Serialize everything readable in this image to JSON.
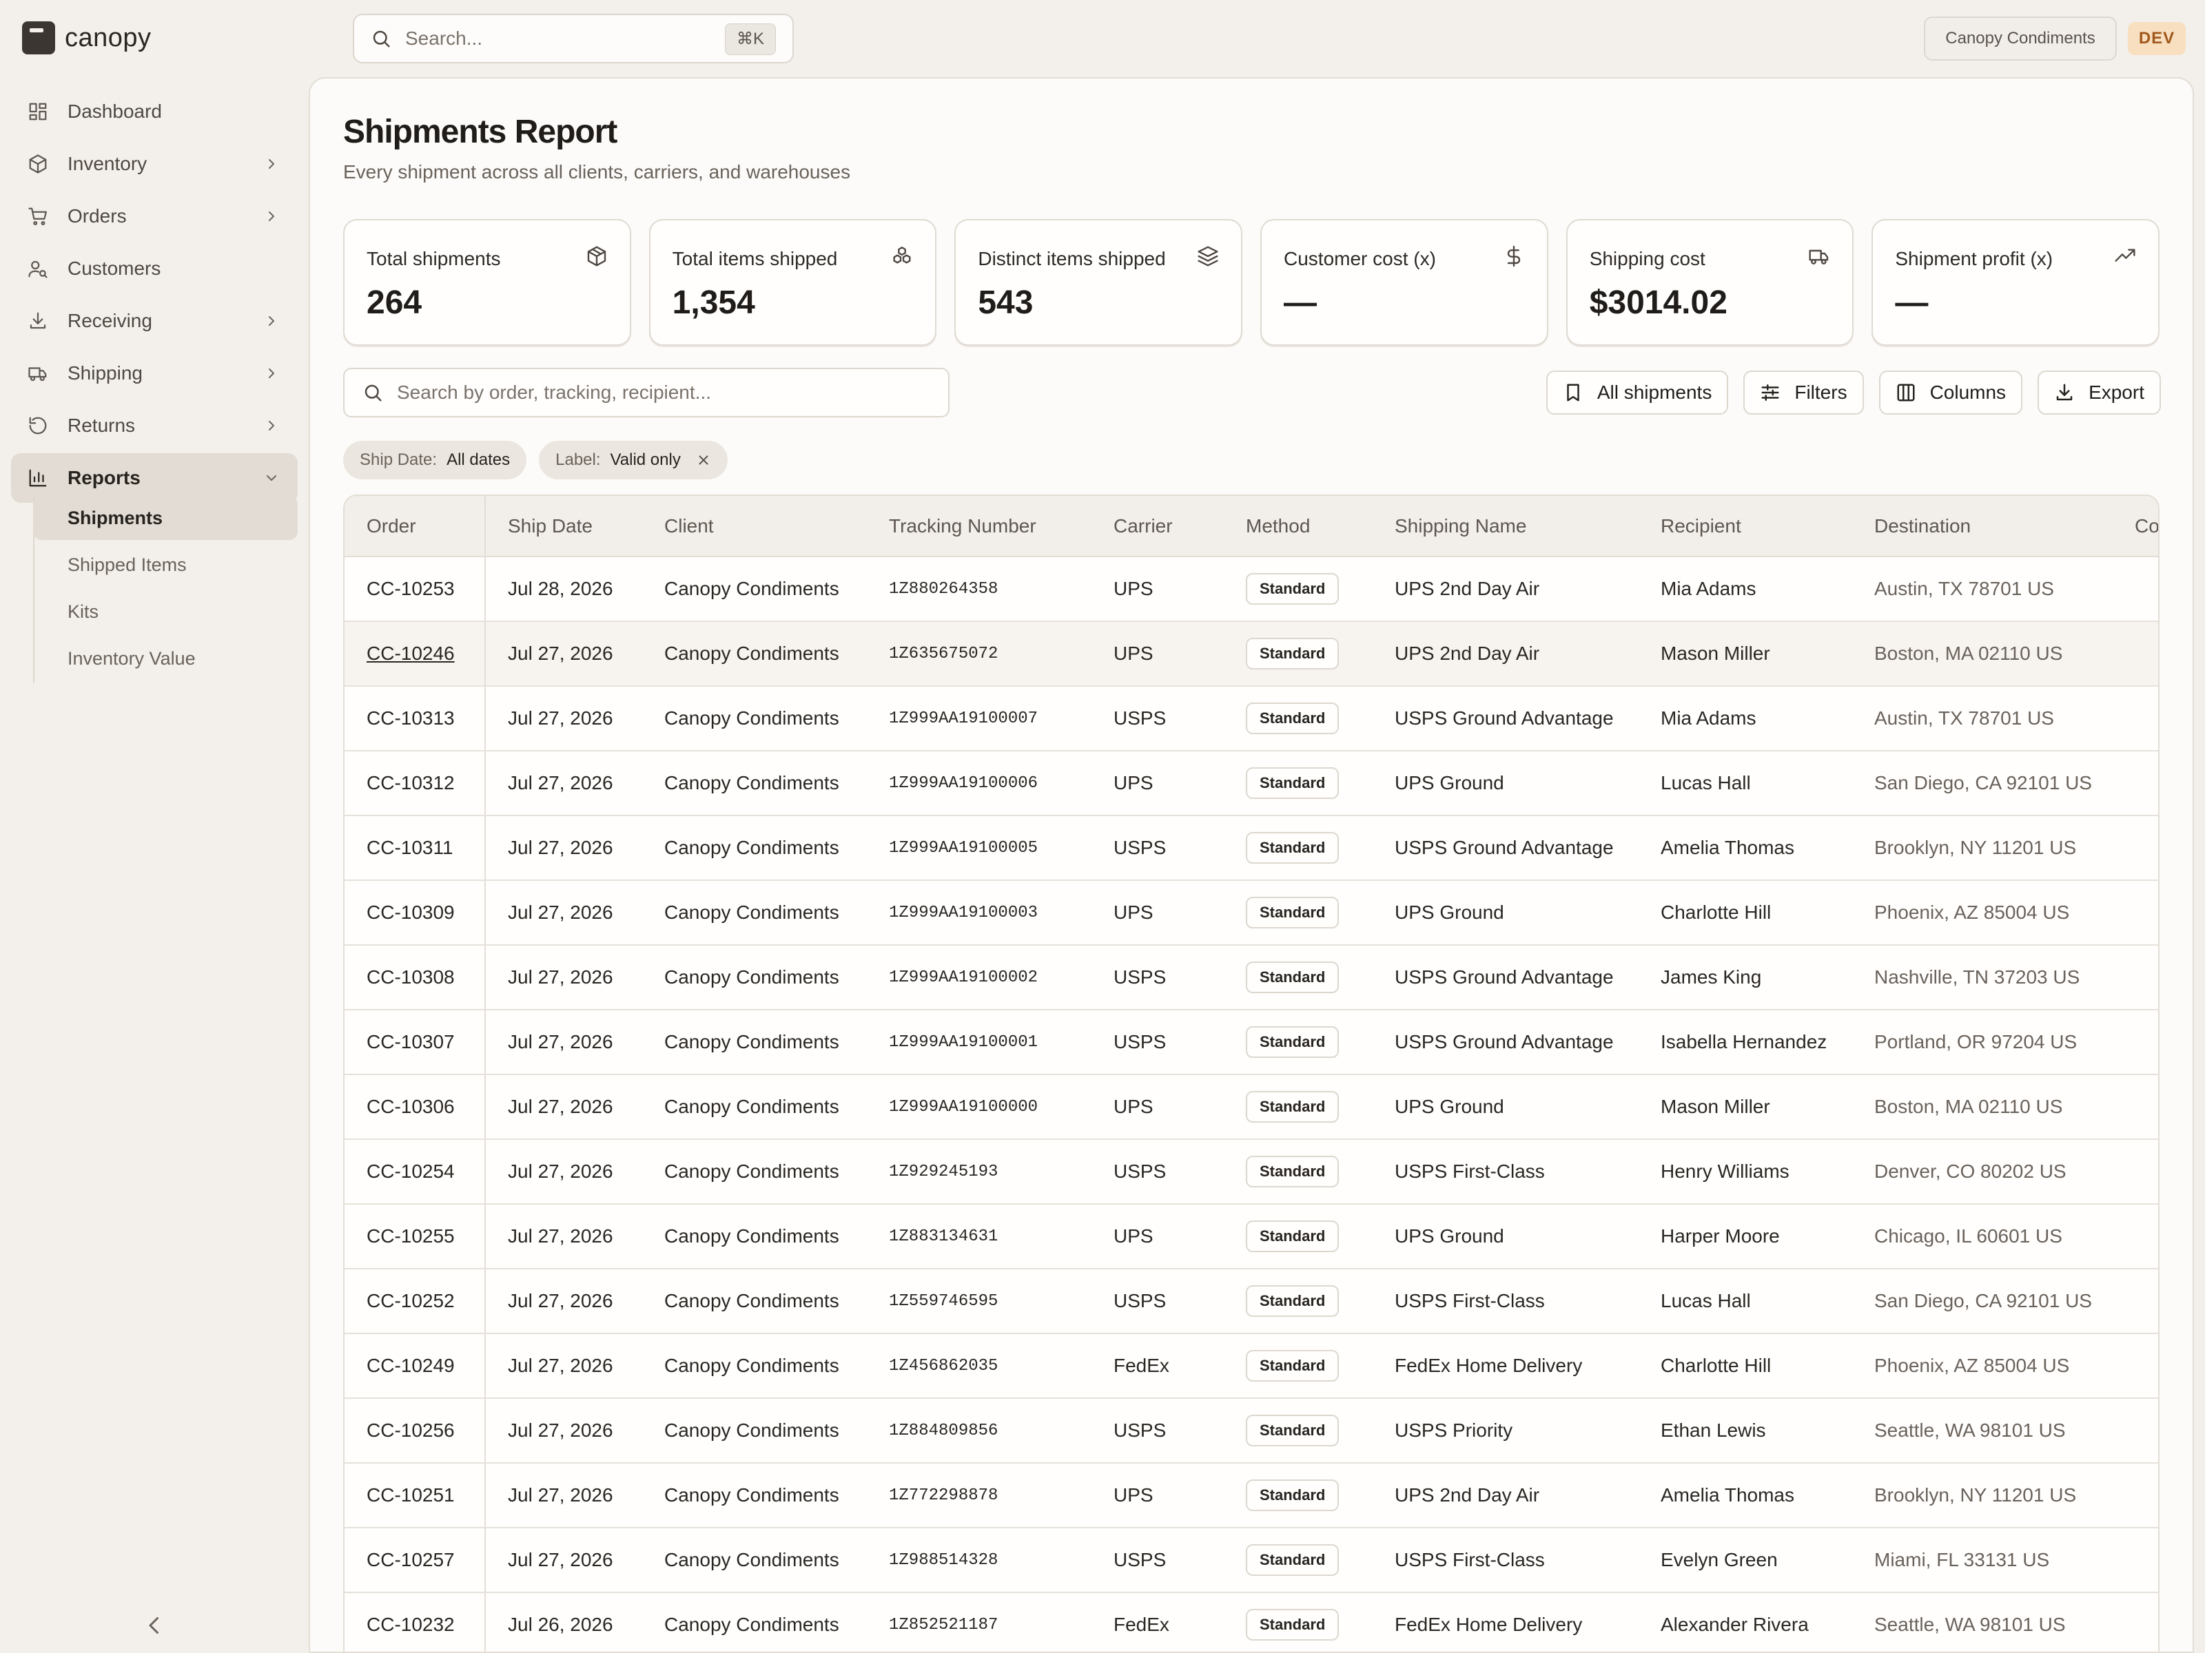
{
  "brand": {
    "name": "canopy"
  },
  "sidebar": {
    "items": [
      {
        "label": "Dashboard",
        "icon": "dashboard-icon",
        "has_chevron": false,
        "active": false
      },
      {
        "label": "Inventory",
        "icon": "box-icon",
        "has_chevron": true,
        "active": false
      },
      {
        "label": "Orders",
        "icon": "cart-icon",
        "has_chevron": true,
        "active": false
      },
      {
        "label": "Customers",
        "icon": "user-search-icon",
        "has_chevron": false,
        "active": false
      },
      {
        "label": "Receiving",
        "icon": "download-icon",
        "has_chevron": true,
        "active": false
      },
      {
        "label": "Shipping",
        "icon": "truck-icon",
        "has_chevron": true,
        "active": false
      },
      {
        "label": "Returns",
        "icon": "return-icon",
        "has_chevron": true,
        "active": false
      },
      {
        "label": "Reports",
        "icon": "bar-chart-icon",
        "has_chevron": true,
        "active": true
      }
    ],
    "subitems": [
      {
        "label": "Shipments",
        "active": true
      },
      {
        "label": "Shipped Items",
        "active": false
      },
      {
        "label": "Kits",
        "active": false
      },
      {
        "label": "Inventory Value",
        "active": false
      }
    ]
  },
  "topbar": {
    "search_placeholder": "Search...",
    "shortcut": "⌘K",
    "org_name": "Canopy Condiments",
    "env_badge": "DEV"
  },
  "page": {
    "title": "Shipments Report",
    "subtitle": "Every shipment across all clients, carriers, and warehouses"
  },
  "stats": [
    {
      "label": "Total shipments",
      "value": "264",
      "icon": "package-icon"
    },
    {
      "label": "Total items shipped",
      "value": "1,354",
      "icon": "boxes-icon"
    },
    {
      "label": "Distinct items shipped",
      "value": "543",
      "icon": "layers-icon"
    },
    {
      "label": "Customer cost (x)",
      "value": "—",
      "icon": "dollar-icon"
    },
    {
      "label": "Shipping cost",
      "value": "$3014.02",
      "icon": "truck-icon"
    },
    {
      "label": "Shipment profit (x)",
      "value": "—",
      "icon": "trending-up-icon"
    }
  ],
  "table_search": {
    "placeholder": "Search by order, tracking, recipient..."
  },
  "toolbar": {
    "saved_view_label": "All shipments",
    "filters_label": "Filters",
    "columns_label": "Columns",
    "export_label": "Export"
  },
  "chips": [
    {
      "key": "Ship Date:",
      "value": "All dates",
      "removable": false
    },
    {
      "key": "Label:",
      "value": "Valid only",
      "removable": true
    }
  ],
  "table": {
    "columns": [
      "Order",
      "Ship Date",
      "Client",
      "Tracking Number",
      "Carrier",
      "Method",
      "Shipping Name",
      "Recipient",
      "Destination",
      "Co"
    ],
    "rows": [
      [
        "CC-10253",
        "Jul 28, 2026",
        "Canopy Condiments",
        "1Z880264358",
        "UPS",
        "Standard",
        "UPS 2nd Day Air",
        "Mia Adams",
        "Austin, TX 78701 US"
      ],
      [
        "CC-10246",
        "Jul 27, 2026",
        "Canopy Condiments",
        "1Z635675072",
        "UPS",
        "Standard",
        "UPS 2nd Day Air",
        "Mason Miller",
        "Boston, MA 02110 US"
      ],
      [
        "CC-10313",
        "Jul 27, 2026",
        "Canopy Condiments",
        "1Z999AA19100007",
        "USPS",
        "Standard",
        "USPS Ground Advantage",
        "Mia Adams",
        "Austin, TX 78701 US"
      ],
      [
        "CC-10312",
        "Jul 27, 2026",
        "Canopy Condiments",
        "1Z999AA19100006",
        "UPS",
        "Standard",
        "UPS Ground",
        "Lucas Hall",
        "San Diego, CA 92101 US"
      ],
      [
        "CC-10311",
        "Jul 27, 2026",
        "Canopy Condiments",
        "1Z999AA19100005",
        "USPS",
        "Standard",
        "USPS Ground Advantage",
        "Amelia Thomas",
        "Brooklyn, NY 11201 US"
      ],
      [
        "CC-10309",
        "Jul 27, 2026",
        "Canopy Condiments",
        "1Z999AA19100003",
        "UPS",
        "Standard",
        "UPS Ground",
        "Charlotte Hill",
        "Phoenix, AZ 85004 US"
      ],
      [
        "CC-10308",
        "Jul 27, 2026",
        "Canopy Condiments",
        "1Z999AA19100002",
        "USPS",
        "Standard",
        "USPS Ground Advantage",
        "James King",
        "Nashville, TN 37203 US"
      ],
      [
        "CC-10307",
        "Jul 27, 2026",
        "Canopy Condiments",
        "1Z999AA19100001",
        "USPS",
        "Standard",
        "USPS Ground Advantage",
        "Isabella Hernandez",
        "Portland, OR 97204 US"
      ],
      [
        "CC-10306",
        "Jul 27, 2026",
        "Canopy Condiments",
        "1Z999AA19100000",
        "UPS",
        "Standard",
        "UPS Ground",
        "Mason Miller",
        "Boston, MA 02110 US"
      ],
      [
        "CC-10254",
        "Jul 27, 2026",
        "Canopy Condiments",
        "1Z929245193",
        "USPS",
        "Standard",
        "USPS First-Class",
        "Henry Williams",
        "Denver, CO 80202 US"
      ],
      [
        "CC-10255",
        "Jul 27, 2026",
        "Canopy Condiments",
        "1Z883134631",
        "UPS",
        "Standard",
        "UPS Ground",
        "Harper Moore",
        "Chicago, IL 60601 US"
      ],
      [
        "CC-10252",
        "Jul 27, 2026",
        "Canopy Condiments",
        "1Z559746595",
        "USPS",
        "Standard",
        "USPS First-Class",
        "Lucas Hall",
        "San Diego, CA 92101 US"
      ],
      [
        "CC-10249",
        "Jul 27, 2026",
        "Canopy Condiments",
        "1Z456862035",
        "FedEx",
        "Standard",
        "FedEx Home Delivery",
        "Charlotte Hill",
        "Phoenix, AZ 85004 US"
      ],
      [
        "CC-10256",
        "Jul 27, 2026",
        "Canopy Condiments",
        "1Z884809856",
        "USPS",
        "Standard",
        "USPS Priority",
        "Ethan Lewis",
        "Seattle, WA 98101 US"
      ],
      [
        "CC-10251",
        "Jul 27, 2026",
        "Canopy Condiments",
        "1Z772298878",
        "UPS",
        "Standard",
        "UPS 2nd Day Air",
        "Amelia Thomas",
        "Brooklyn, NY 11201 US"
      ],
      [
        "CC-10257",
        "Jul 27, 2026",
        "Canopy Condiments",
        "1Z988514328",
        "USPS",
        "Standard",
        "USPS First-Class",
        "Evelyn Green",
        "Miami, FL 33131 US"
      ],
      [
        "CC-10232",
        "Jul 26, 2026",
        "Canopy Condiments",
        "1Z852521187",
        "FedEx",
        "Standard",
        "FedEx Home Delivery",
        "Alexander Rivera",
        "Seattle, WA 98101 US"
      ]
    ],
    "hovered_row_index": 1
  },
  "colors": {
    "background": "#f3f0eb",
    "panel": "#fcfbf9",
    "active_nav": "#e2dcd4",
    "dev_badge_bg": "#f7dfc0",
    "dev_badge_text": "#a2581c"
  }
}
